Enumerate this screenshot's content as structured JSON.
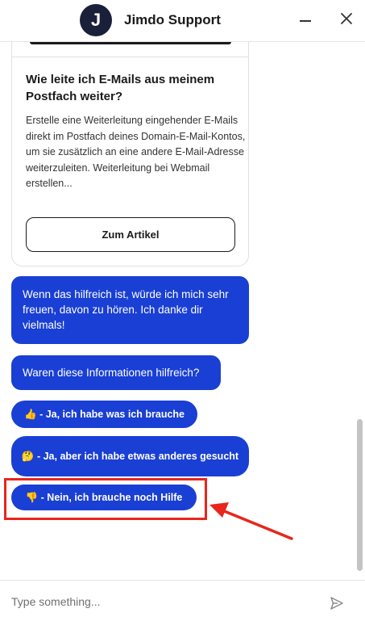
{
  "header": {
    "logo_letter": "J",
    "title": "Jimdo Support"
  },
  "article_card": {
    "title": "Wie leite ich E-Mails aus meinem Postfach weiter?",
    "excerpt": "Erstelle eine Weiterleitung eingehender E-Mails direkt im Postfach deines Domain-E-Mail-Kontos, um sie zusätzlich an eine andere E-Mail-Adresse weiterzuleiten. Weiterleitung bei Webmail erstellen...",
    "button_label": "Zum Artikel"
  },
  "messages": [
    {
      "text": "Wenn das hilfreich ist, würde ich mich sehr freuen, davon zu hören. Ich danke dir vielmals!"
    },
    {
      "text": "Waren diese Informationen hilfreich?"
    }
  ],
  "quick_replies": [
    {
      "emoji": "👍",
      "label": "- Ja, ich habe was ich brauche"
    },
    {
      "emoji": "🤔",
      "label": "- Ja, aber ich habe etwas anderes gesucht"
    },
    {
      "emoji": "👎",
      "label": "- Nein, ich brauche noch Hilfe"
    }
  ],
  "composer": {
    "placeholder": "Type something..."
  },
  "colors": {
    "accent": "#1a3fd4",
    "highlight": "#e8261c",
    "logo_bg": "#1a1f3a"
  },
  "icons": {
    "minimize": "minimize-icon",
    "close": "close-icon",
    "send": "send-icon"
  }
}
